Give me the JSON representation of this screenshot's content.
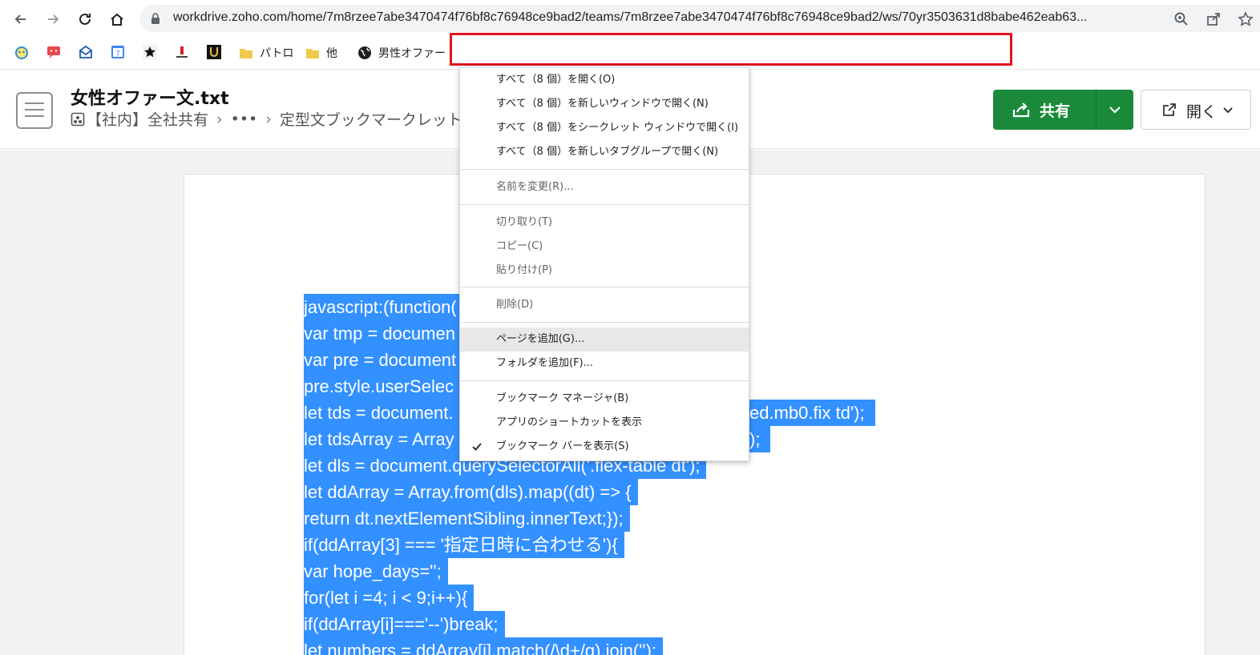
{
  "browser": {
    "url": "workdrive.zoho.com/home/7m8rzee7abe3470474f76bf8c76948ce9bad2/teams/7m8rzee7abe3470474f76bf8c76948ce9bad2/ws/70yr3503631d8babe462eab63..."
  },
  "bookmarks": {
    "items": [
      {
        "label": "パトロ"
      },
      {
        "label": "他"
      },
      {
        "label": "男性オファー"
      }
    ]
  },
  "file": {
    "title": "女性オファー文.txt",
    "breadcrumb": [
      "【社内】全社共有",
      "•••",
      "定型文ブックマークレット"
    ]
  },
  "actions": {
    "share_label": "共有",
    "open_label": "開く"
  },
  "code": {
    "lines": [
      "javascript:(function(",
      "var tmp = documen",
      "var pre = document",
      "pre.style.userSelec",
      "let tds = document.",
      "let tdsArray = Array",
      "let dls = document.querySelectorAll('.flex-table dt');",
      "let ddArray = Array.from(dls).map((dt) => {",
      "return dt.nextElementSibling.innerText;});",
      "if(ddArray[3] === '指定日時に合わせる'){",
      "var hope_days='';",
      "for(let i =4; i < 9;i++){",
      "if(ddArray[i]==='--')break;",
      "let numbers = ddArray[i].match(/\\d+/g).join('');"
    ],
    "tail_line5": "ed.mb0.fix td');",
    "tail_line6": ");"
  },
  "context_menu": {
    "items": [
      "すべて（8 個）を開く(O)",
      "すべて（8 個）を新しいウィンドウで開く(N)",
      "すべて（8 個）をシークレット ウィンドウで開く(I)",
      "すべて（8 個）を新しいタブグループで開く(N)",
      "名前を変更(R)...",
      "切り取り(T)",
      "コピー(C)",
      "貼り付け(P)",
      "削除(D)",
      "ページを追加(G)...",
      "フォルダを追加(F)...",
      "ブックマーク マネージャ(B)",
      "アプリのショートカットを表示",
      "ブックマーク バーを表示(S)"
    ]
  },
  "colors": {
    "share_green": "#1a8a3a",
    "selection_blue": "#3390ff",
    "highlight_red": "#e0141e"
  }
}
